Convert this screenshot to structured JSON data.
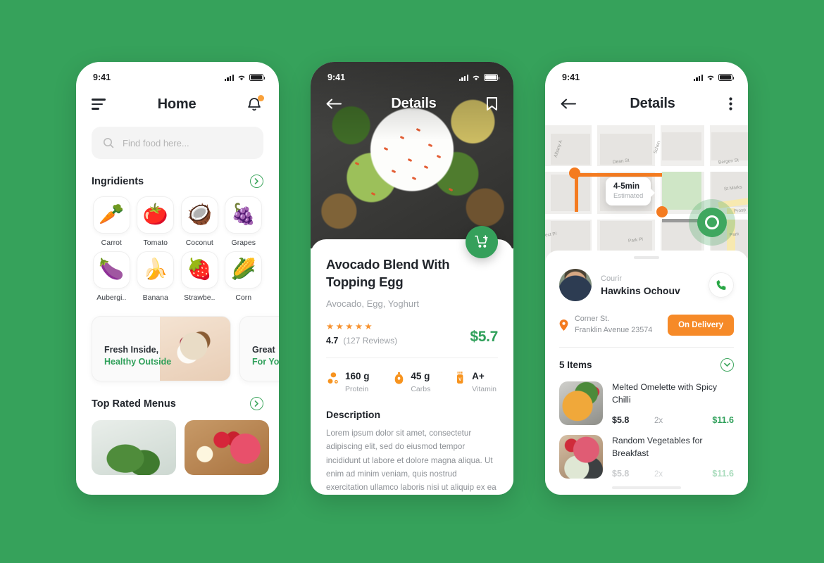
{
  "theme": {
    "background": "#36A25B",
    "green": "#2FA05A",
    "green_accent": "#3FA75F",
    "orange": "#F47B20",
    "orange_badge": "#F68A28",
    "star": "#F79331",
    "text_dark": "#21252b",
    "text_muted": "#9fa3a8"
  },
  "phone1": {
    "status": {
      "time": "9:41",
      "signal_icon": "signal-bars-icon",
      "wifi_icon": "wifi-icon",
      "battery_icon": "battery-icon"
    },
    "nav": {
      "menu_icon": "hamburger-menu-icon",
      "title": "Home",
      "bell_icon": "notification-bell-icon"
    },
    "search": {
      "icon": "search-icon",
      "placeholder": "Find food here...",
      "value": ""
    },
    "ingredients_section": {
      "title": "Ingridients",
      "chevron_icon": "chevron-right-circle-icon"
    },
    "ingredients": [
      {
        "label": "Carrot",
        "emoji": "🥕"
      },
      {
        "label": "Tomato",
        "emoji": "🍅"
      },
      {
        "label": "Coconut",
        "emoji": "🥥"
      },
      {
        "label": "Grapes",
        "emoji": "🍇"
      },
      {
        "label": "Aubergi..",
        "emoji": "🍆"
      },
      {
        "label": "Banana",
        "emoji": "🍌"
      },
      {
        "label": "Strawbe..",
        "emoji": "🍓"
      },
      {
        "label": "Corn",
        "emoji": "🌽"
      }
    ],
    "promos": [
      {
        "line1": "Fresh Inside,",
        "line2": "Healthy Outside"
      },
      {
        "line1": "Great",
        "line2": "For Yo"
      }
    ],
    "top_rated_section": {
      "title": "Top Rated Menus",
      "chevron_icon": "chevron-right-circle-icon"
    }
  },
  "phone2": {
    "status": {
      "time": "9:41",
      "signal_icon": "signal-bars-icon",
      "wifi_icon": "wifi-icon",
      "battery_icon": "battery-icon"
    },
    "nav": {
      "back_icon": "arrow-left-icon",
      "title": "Details",
      "bookmark_icon": "bookmark-icon"
    },
    "cart_fab_icon": "cart-plus-icon",
    "food": {
      "title": "Avocado Blend With Topping Egg",
      "subtitle": "Avocado, Egg, Yoghurt",
      "stars": "★★★★★",
      "rating": "4.7",
      "reviews": "(127 Reviews)",
      "price": "$5.7"
    },
    "nutrition": [
      {
        "value": "160 g",
        "label": "Protein",
        "icon": "protein-icon"
      },
      {
        "value": "45 g",
        "label": "Carbs",
        "icon": "carbs-icon"
      },
      {
        "value": "A+",
        "label": "Vitamin",
        "icon": "vitamin-icon"
      }
    ],
    "description": {
      "heading": "Description",
      "body": "Lorem ipsum dolor sit amet, consectetur adipiscing elit, sed do eiusmod tempor incididunt ut labore et dolore magna aliqua. Ut enim ad minim veniam, quis nostrud exercitation ullamco laboris nisi ut aliquip ex ea commodo"
    }
  },
  "phone3": {
    "status": {
      "time": "9:41",
      "signal_icon": "signal-bars-icon",
      "wifi_icon": "wifi-icon",
      "battery_icon": "battery-icon"
    },
    "nav": {
      "back_icon": "arrow-left-icon",
      "title": "Details",
      "more_icon": "more-vertical-icon"
    },
    "map": {
      "tooltip_time": "4-5min",
      "tooltip_label": "Estimated",
      "street_labels": [
        "Dean St",
        "Bergen St",
        "St Marks",
        "Park Pl",
        "Prospect Pl",
        "Albany A",
        "Schen",
        "Prosp",
        "Park"
      ],
      "origin_icon": "route-origin-dot",
      "destination_icon": "destination-marker-icon"
    },
    "courier": {
      "role": "Courir",
      "name": "Hawkins Ochouv",
      "avatar_icon": "courier-avatar",
      "call_icon": "phone-call-icon",
      "address_icon": "location-pin-icon",
      "address_line1": "Corner St.",
      "address_line2": "Franklin Avenue 23574",
      "status_badge": "On Delivery"
    },
    "items_section": {
      "title": "5 Items",
      "collapse_icon": "chevron-down-circle-icon"
    },
    "items": [
      {
        "name": "Melted Omelette with Spicy Chilli",
        "price": "$5.8",
        "qty": "2x",
        "total": "$11.6",
        "thumb": "omelette"
      },
      {
        "name": "Random Vegetables for Breakfast",
        "price": "$5.8",
        "qty": "2x",
        "total": "$11.6",
        "thumb": "veg"
      }
    ]
  }
}
